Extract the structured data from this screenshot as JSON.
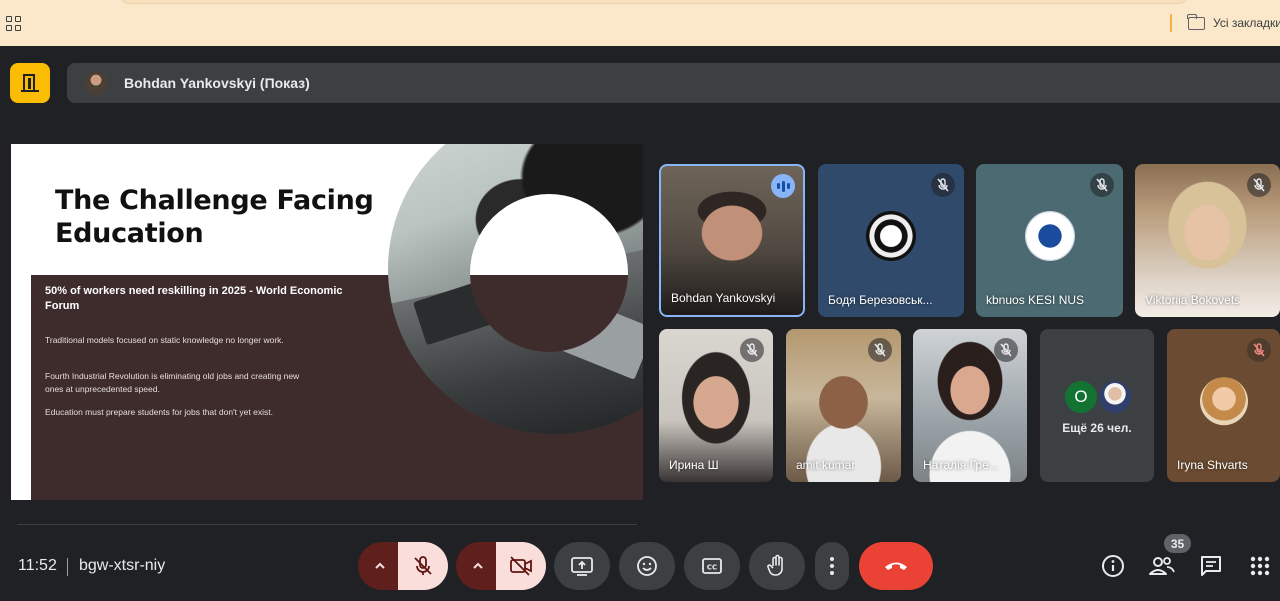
{
  "browser": {
    "bookmarks_folder_label": "Усі закладки"
  },
  "meet": {
    "presenter_label": "Bohdan Yankovskyi (Показ)",
    "time": "11:52",
    "meeting_code": "bgw-xtsr-niy",
    "people_count": "35"
  },
  "slide": {
    "title": "The Challenge Facing Education",
    "subtitle": "50% of workers need reskilling in 2025 - World Economic Forum",
    "bullets": [
      "Traditional models focused on static knowledge no longer work.",
      "Fourth Industrial Revolution is eliminating old jobs and creating new ones at unprecedented speed.",
      "Education must prepare students for jobs that don't yet exist."
    ]
  },
  "participants": [
    {
      "name": "Bohdan Yankovskyi",
      "state": "speaking"
    },
    {
      "name": "Бодя Березовськ...",
      "state": "muted"
    },
    {
      "name": "kbnuos KESI NUS",
      "state": "muted"
    },
    {
      "name": "Viktoriia Bokovets",
      "state": "muted"
    },
    {
      "name": "Ирина Ш",
      "state": "muted"
    },
    {
      "name": "amit kumar",
      "state": "muted"
    },
    {
      "name": "Наталія Гре...",
      "state": "muted"
    },
    {
      "name": "Ещё 26 чел.",
      "avatar_letter": "O"
    },
    {
      "name": "Iryna Shvarts",
      "state": "muted"
    }
  ],
  "colors": {
    "exit_button": "#fbbc04",
    "end_call": "#ea4335",
    "muted_control_bg": "#f9dedc",
    "slide_panel": "#3e2c2d",
    "speaking_indicator": "#8ab4f8"
  },
  "icons": {
    "exit": "door-icon",
    "mic": "mic-off-icon",
    "camera": "videocam-off-icon",
    "present": "present-to-all-icon",
    "reactions": "emoji-icon",
    "captions": "closed-captions-icon",
    "raise_hand": "hand-icon",
    "more": "more-vert-icon",
    "end": "call-end-icon",
    "info": "info-icon",
    "people": "people-icon",
    "chat": "chat-icon",
    "activities": "apps-grid-icon"
  }
}
